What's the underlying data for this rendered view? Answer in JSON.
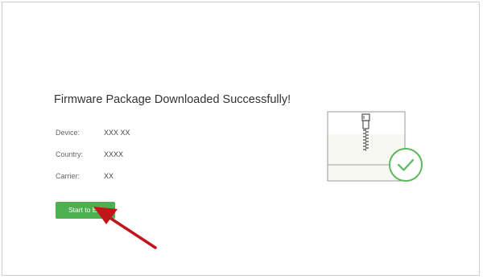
{
  "page": {
    "title": "Firmware Package Downloaded Successfully!"
  },
  "details": [
    {
      "label": "Device:",
      "value": "XXX XX"
    },
    {
      "label": "Country:",
      "value": "XXXX"
    },
    {
      "label": "Carrier:",
      "value": "XX"
    }
  ],
  "actions": {
    "start_label": "Start to Ext"
  },
  "illustration": {
    "icon": "zip-archive-icon",
    "badge_icon": "check-circle-icon"
  },
  "colors": {
    "accent_green": "#4caf50",
    "annotation_red": "#c0161b"
  }
}
